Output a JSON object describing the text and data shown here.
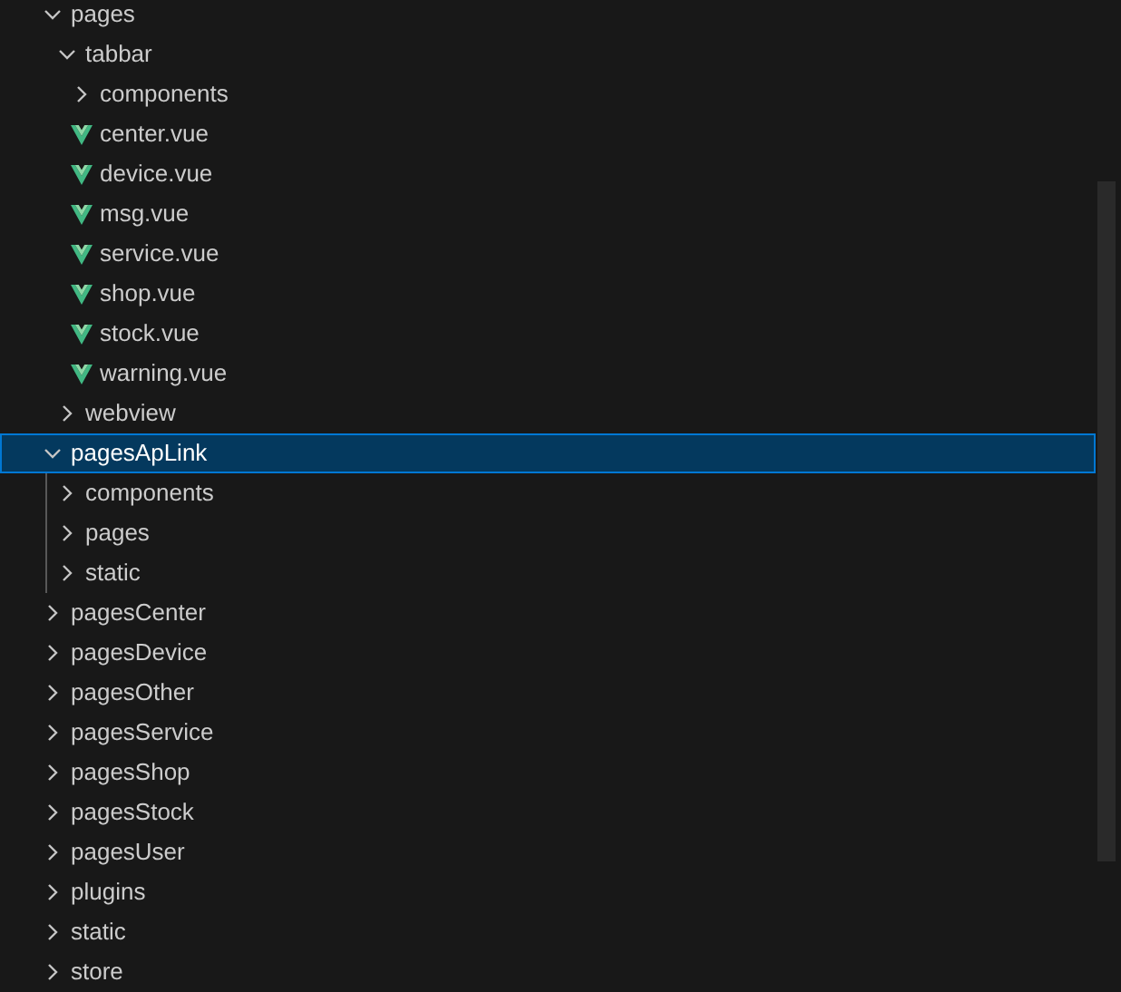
{
  "explorer": {
    "items": [
      {
        "name": "pages",
        "kind": "folder",
        "expanded": true,
        "selected": false,
        "children": [
          {
            "name": "tabbar",
            "kind": "folder",
            "expanded": true,
            "selected": false,
            "children": [
              {
                "name": "components",
                "kind": "folder",
                "expanded": false,
                "selected": false
              },
              {
                "name": "center.vue",
                "kind": "vue",
                "selected": false
              },
              {
                "name": "device.vue",
                "kind": "vue",
                "selected": false
              },
              {
                "name": "msg.vue",
                "kind": "vue",
                "selected": false
              },
              {
                "name": "service.vue",
                "kind": "vue",
                "selected": false
              },
              {
                "name": "shop.vue",
                "kind": "vue",
                "selected": false
              },
              {
                "name": "stock.vue",
                "kind": "vue",
                "selected": false
              },
              {
                "name": "warning.vue",
                "kind": "vue",
                "selected": false
              }
            ]
          },
          {
            "name": "webview",
            "kind": "folder",
            "expanded": false,
            "selected": false
          }
        ]
      },
      {
        "name": "pagesApLink",
        "kind": "folder",
        "expanded": true,
        "selected": true,
        "children": [
          {
            "name": "components",
            "kind": "folder",
            "expanded": false,
            "selected": false
          },
          {
            "name": "pages",
            "kind": "folder",
            "expanded": false,
            "selected": false
          },
          {
            "name": "static",
            "kind": "folder",
            "expanded": false,
            "selected": false
          }
        ]
      },
      {
        "name": "pagesCenter",
        "kind": "folder",
        "expanded": false,
        "selected": false
      },
      {
        "name": "pagesDevice",
        "kind": "folder",
        "expanded": false,
        "selected": false
      },
      {
        "name": "pagesOther",
        "kind": "folder",
        "expanded": false,
        "selected": false
      },
      {
        "name": "pagesService",
        "kind": "folder",
        "expanded": false,
        "selected": false
      },
      {
        "name": "pagesShop",
        "kind": "folder",
        "expanded": false,
        "selected": false
      },
      {
        "name": "pagesStock",
        "kind": "folder",
        "expanded": false,
        "selected": false
      },
      {
        "name": "pagesUser",
        "kind": "folder",
        "expanded": false,
        "selected": false
      },
      {
        "name": "plugins",
        "kind": "folder",
        "expanded": false,
        "selected": false
      },
      {
        "name": "static",
        "kind": "folder",
        "expanded": false,
        "selected": false
      },
      {
        "name": "store",
        "kind": "folder",
        "expanded": false,
        "selected": false
      }
    ]
  }
}
